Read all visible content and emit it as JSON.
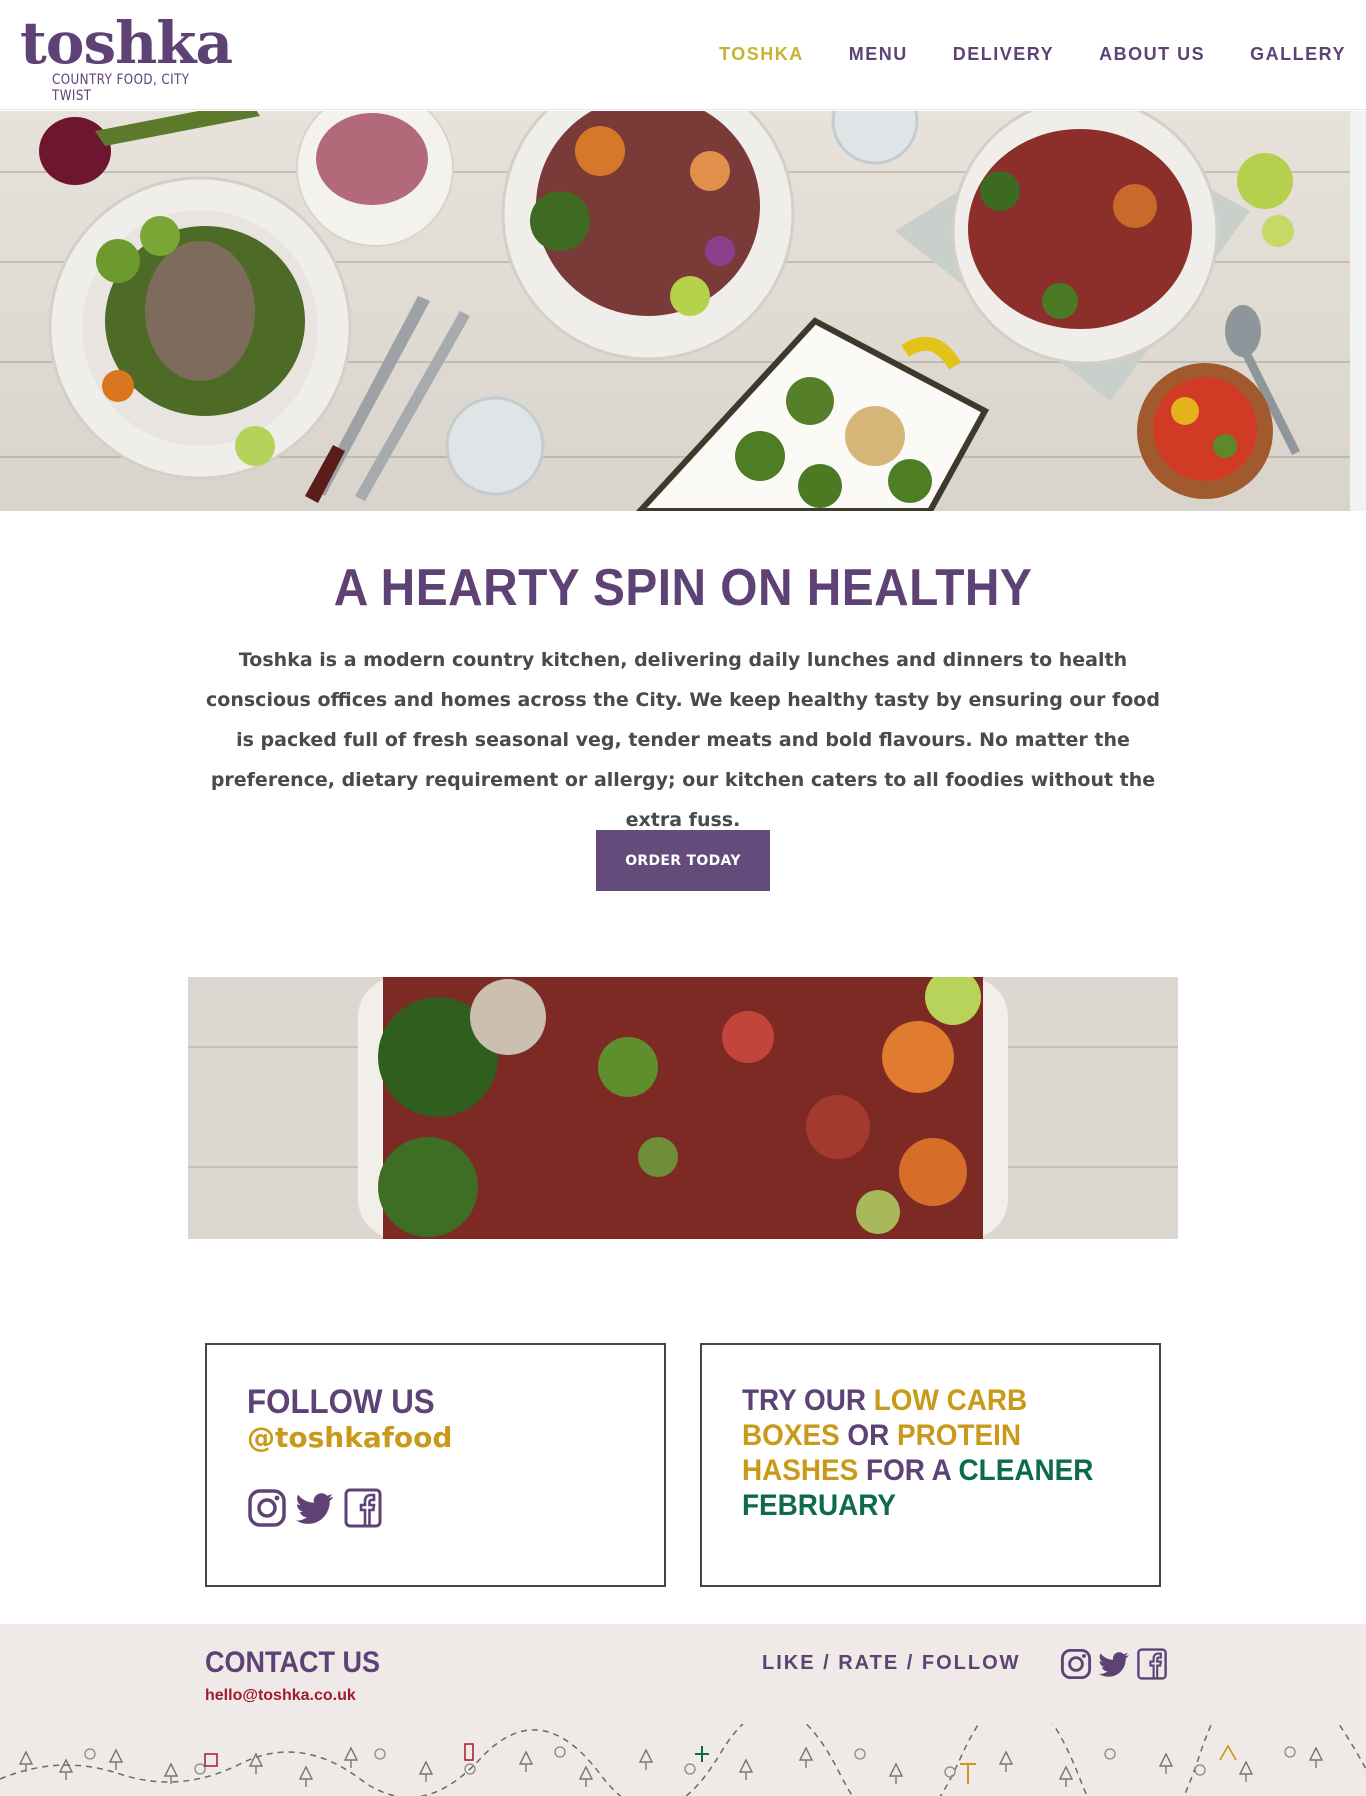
{
  "header": {
    "logo_word": "toshka",
    "logo_tagline": "COUNTRY FOOD, CITY TWIST",
    "nav": [
      {
        "label": "TOSHKA",
        "active": true
      },
      {
        "label": "MENU",
        "active": false
      },
      {
        "label": "DELIVERY",
        "active": false
      },
      {
        "label": "ABOUT US",
        "active": false
      },
      {
        "label": "GALLERY",
        "active": false
      }
    ]
  },
  "intro": {
    "headline": "A HEARTY SPIN ON HEALTHY",
    "body": "Toshka is a modern country kitchen, delivering daily lunches and dinners to health conscious offices and homes across the City. We keep healthy tasty by ensuring our food is packed full of fresh seasonal veg, tender meats and bold flavours. No matter the preference, dietary requirement or allergy; our kitchen caters to all foodies without the extra fuss.",
    "cta_label": "ORDER TODAY"
  },
  "follow_box": {
    "title": "FOLLOW US",
    "handle": "@toshkafood",
    "icons": [
      "instagram-icon",
      "twitter-icon",
      "facebook-icon"
    ]
  },
  "promo_box": {
    "parts": [
      {
        "text": "TRY OUR ",
        "style": "purple"
      },
      {
        "text": "LOW CARB BOXES",
        "style": "gold"
      },
      {
        "text": " OR ",
        "style": "purple"
      },
      {
        "text": "PROTEIN HASHES",
        "style": "gold"
      },
      {
        "text": " FOR A ",
        "style": "purple"
      },
      {
        "text": "CLEANER FEBRUARY",
        "style": "green"
      }
    ]
  },
  "footer": {
    "contact_title": "CONTACT US",
    "email": "hello@toshka.co.uk",
    "social_label": "LIKE / RATE / FOLLOW",
    "icons": [
      "instagram-icon",
      "twitter-icon",
      "facebook-icon"
    ]
  },
  "colors": {
    "brand_purple": "#5e4275",
    "button_purple": "#654a7c",
    "accent_gold": "#c99a1a",
    "nav_active": "#c9b232",
    "accent_green": "#0d6a4f",
    "email_red": "#a01b2f"
  }
}
